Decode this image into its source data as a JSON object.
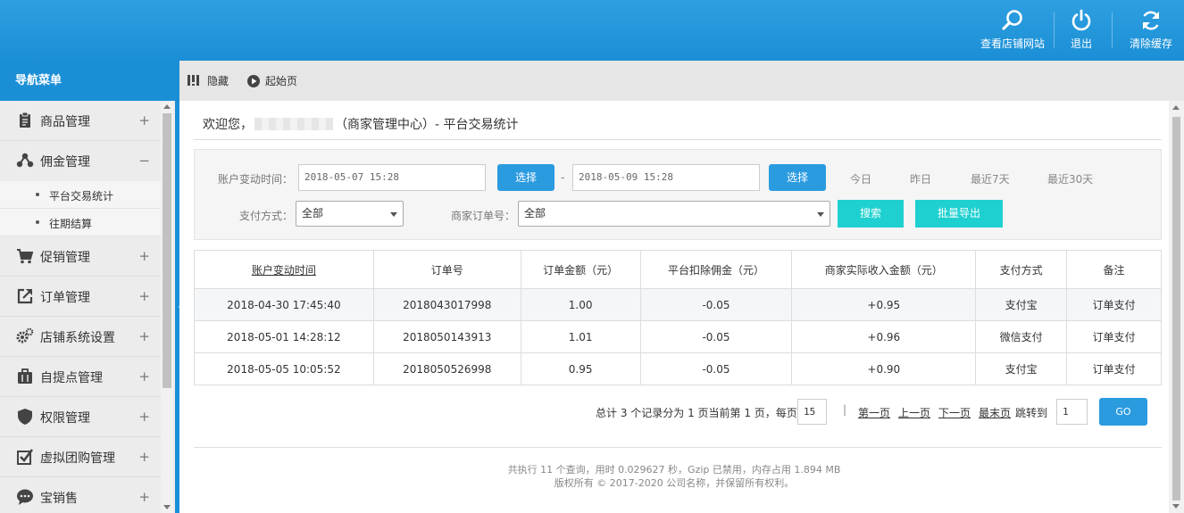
{
  "header": {
    "buttons": [
      {
        "label": "查看店铺网站",
        "icon": "search-icon"
      },
      {
        "label": "退出",
        "icon": "power-icon"
      },
      {
        "label": "清除缓存",
        "icon": "refresh-icon"
      }
    ]
  },
  "sidebar": {
    "title": "导航菜单",
    "items": [
      {
        "label": "商品管理",
        "icon": "clipboard-icon",
        "toggle": "+"
      },
      {
        "label": "佣金管理",
        "icon": "share-icon",
        "toggle": "−"
      },
      {
        "label": "促销管理",
        "icon": "cart-icon",
        "toggle": "+"
      },
      {
        "label": "订单管理",
        "icon": "external-link-icon",
        "toggle": "+"
      },
      {
        "label": "店铺系统设置",
        "icon": "gears-icon",
        "toggle": "+"
      },
      {
        "label": "自提点管理",
        "icon": "briefcase-icon",
        "toggle": "+"
      },
      {
        "label": "权限管理",
        "icon": "shield-icon",
        "toggle": "+"
      },
      {
        "label": "虚拟团购管理",
        "icon": "checkbox-icon",
        "toggle": "+"
      },
      {
        "label": "宝销售",
        "icon": "chat-icon",
        "toggle": "+"
      }
    ],
    "subitems": [
      "平台交易统计",
      "往期结算"
    ]
  },
  "toolbar": {
    "hide": "隐藏",
    "home": "起始页"
  },
  "welcome": {
    "prefix": "欢迎您，",
    "suffix": "（商家管理中心）- 平台交易统计"
  },
  "filter": {
    "time_label": "账户变动时间：",
    "start": "2018-05-07 15:28",
    "end": "2018-05-09 15:28",
    "choose": "选择",
    "dash": "-",
    "quick": [
      "今日",
      "昨日",
      "最近7天",
      "最近30天"
    ],
    "pay_label": "支付方式：",
    "pay_value": "全部",
    "order_label": "商家订单号：",
    "order_value": "全部",
    "search": "搜索",
    "export": "批量导出"
  },
  "table": {
    "headers": [
      "账户变动时间",
      "订单号",
      "订单金额（元）",
      "平台扣除佣金（元）",
      "商家实际收入金额（元）",
      "支付方式",
      "备注"
    ],
    "rows": [
      [
        "2018-04-30 17:45:40",
        "2018043017998",
        "1.00",
        "-0.05",
        "+0.95",
        "支付宝",
        "订单支付"
      ],
      [
        "2018-05-01 14:28:12",
        "2018050143913",
        "1.01",
        "-0.05",
        "+0.96",
        "微信支付",
        "订单支付"
      ],
      [
        "2018-05-05 10:05:52",
        "2018050526998",
        "0.95",
        "-0.05",
        "+0.90",
        "支付宝",
        "订单支付"
      ]
    ]
  },
  "pager": {
    "summary": "总计 3 个记录分为 1 页当前第 1 页，每页",
    "per_page": "15",
    "sep": "|",
    "first": "第一页",
    "prev": "上一页",
    "next": "下一页",
    "last": "最末页",
    "jump": "跳转到",
    "page": "1",
    "go": "GO"
  },
  "footer": {
    "line1": "共执行 11 个查询，用时 0.029627 秒，Gzip 已禁用，内存占用 1.894 MB",
    "line2": "版权所有 © 2017-2020 公司名称，并保留所有权利。"
  }
}
